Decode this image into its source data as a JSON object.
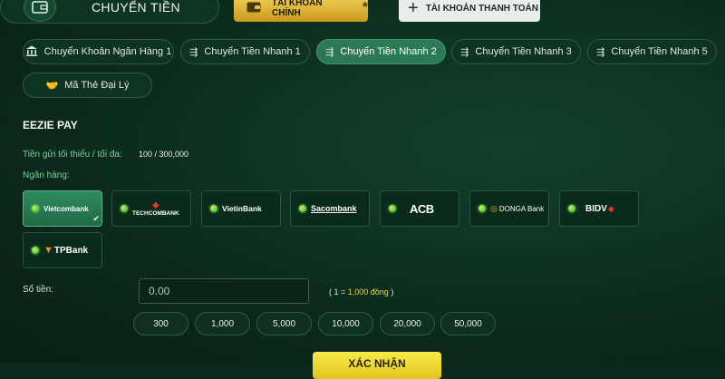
{
  "header": {
    "title": "CHUYỂN TIỀN",
    "main_account_label": "TÀI KHOẢN CHÍNH",
    "main_account_star": "*",
    "payment_account_label": "TÀI KHOẢN THANH TOÁN"
  },
  "tabs": [
    {
      "label": "Chuyển Khoản Ngân Hàng 1",
      "icon": "bank-icon"
    },
    {
      "label": "Chuyển Tiền Nhanh 1",
      "icon": "fast-transfer-icon"
    },
    {
      "label": "Chuyển Tiền Nhanh 2",
      "icon": "fast-transfer-icon",
      "active": true
    },
    {
      "label": "Chuyển Tiền Nhanh 3",
      "icon": "fast-transfer-icon"
    },
    {
      "label": "Chuyển Tiền Nhanh 5",
      "icon": "fast-transfer-icon"
    },
    {
      "label": "Mã Thẻ Đại Lý",
      "icon": "handshake-icon"
    }
  ],
  "section_title": "EEZIE PAY",
  "limits": {
    "label": "Tiền gửi tối thiểu / tối đa:",
    "value": "100 / 300,000"
  },
  "bank_label": "Ngân hàng:",
  "banks": [
    {
      "name": "Vietcombank",
      "selected": true
    },
    {
      "name": "TECHCOMBANK"
    },
    {
      "name": "VietinBank"
    },
    {
      "name": "Sacombank"
    },
    {
      "name": "ACB"
    },
    {
      "name": "DONGA Bank"
    },
    {
      "name": "BIDV"
    },
    {
      "name": "TPBank"
    }
  ],
  "amount": {
    "label": "Số tiền:",
    "placeholder": "0.00",
    "value": "",
    "rate_prefix": "( 1 = ",
    "rate_value": "1,000 đồng",
    "rate_suffix": " )"
  },
  "quick_amounts": [
    "300",
    "1,000",
    "5,000",
    "10,000",
    "20,000",
    "50,000"
  ],
  "confirm_label": "XÁC NHẬN",
  "colors": {
    "accent": "#2c7a55",
    "gold": "#e2c51c",
    "background": "#0b2a1c"
  }
}
